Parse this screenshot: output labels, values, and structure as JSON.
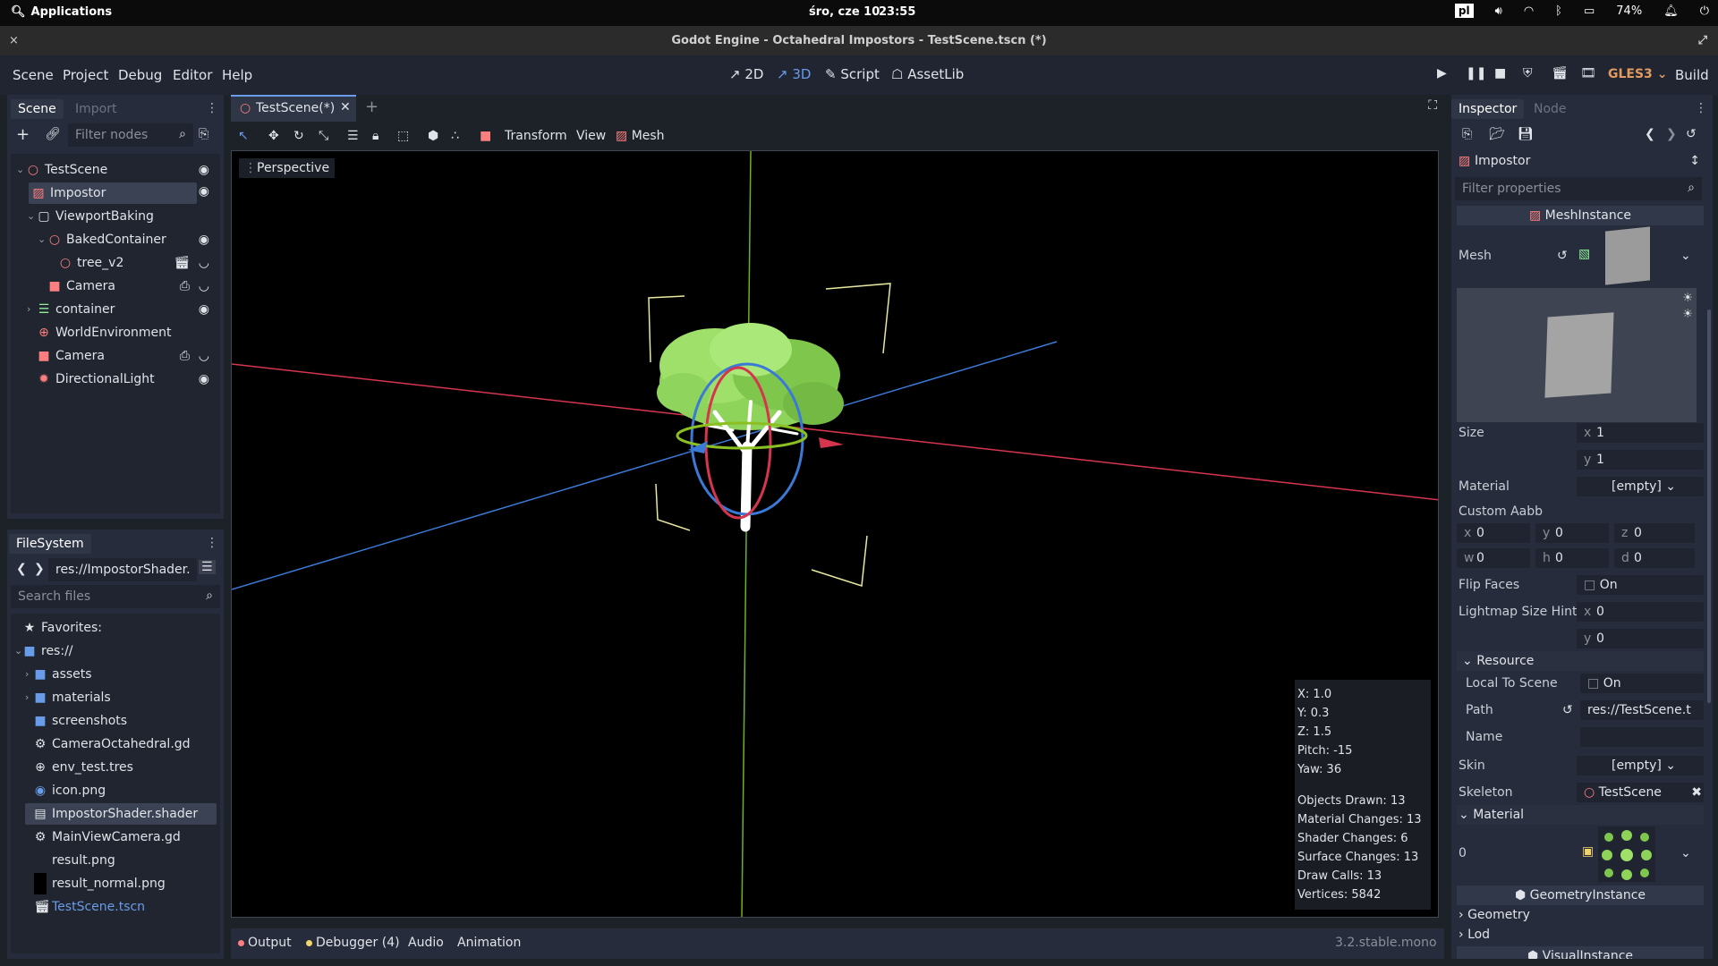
{
  "os_bar": {
    "applications": "Applications",
    "date": "śro, cze 10",
    "time": "23:55",
    "keyboard": "pl",
    "battery": "74%"
  },
  "window": {
    "title": "Godot Engine - Octahedral Impostors - TestScene.tscn (*)",
    "close": "×"
  },
  "menu": {
    "items": [
      "Scene",
      "Project",
      "Debug",
      "Editor",
      "Help"
    ],
    "workspaces": [
      "2D",
      "3D",
      "Script",
      "AssetLib"
    ],
    "renderer": "GLES3",
    "build": "Build"
  },
  "scene_dock": {
    "tabs": [
      "Scene",
      "Import"
    ],
    "filter_placeholder": "Filter nodes",
    "nodes": [
      {
        "name": "TestScene"
      },
      {
        "name": "Impostor"
      },
      {
        "name": "ViewportBaking"
      },
      {
        "name": "BakedContainer"
      },
      {
        "name": "tree_v2"
      },
      {
        "name": "Camera"
      },
      {
        "name": "container"
      },
      {
        "name": "WorldEnvironment"
      },
      {
        "name": "Camera"
      },
      {
        "name": "DirectionalLight"
      }
    ]
  },
  "filesystem": {
    "tab": "FileSystem",
    "path": "res://ImpostorShader.",
    "search_placeholder": "Search files",
    "items": [
      {
        "name": "Favorites:"
      },
      {
        "name": "res://"
      },
      {
        "name": "assets"
      },
      {
        "name": "materials"
      },
      {
        "name": "screenshots"
      },
      {
        "name": "CameraOctahedral.gd"
      },
      {
        "name": "env_test.tres"
      },
      {
        "name": "icon.png"
      },
      {
        "name": "ImpostorShader.shader"
      },
      {
        "name": "MainViewCamera.gd"
      },
      {
        "name": "result.png"
      },
      {
        "name": "result_normal.png"
      },
      {
        "name": "TestScene.tscn"
      }
    ]
  },
  "editor": {
    "scene_tab": "TestScene(*)",
    "toolbar": [
      "Transform",
      "View",
      "Mesh"
    ],
    "perspective": "Perspective",
    "stats": {
      "x": "X: 1.0",
      "y": "Y: 0.3",
      "z": "Z: 1.5",
      "pitch": "Pitch: -15",
      "yaw": "Yaw: 36",
      "objects": "Objects Drawn: 13",
      "materials": "Material Changes: 13",
      "shaders": "Shader Changes: 6",
      "surfaces": "Surface Changes: 13",
      "draw_calls": "Draw Calls: 13",
      "vertices": "Vertices: 5842"
    }
  },
  "bottom_panel": {
    "tabs": [
      "Output",
      "Debugger (4)",
      "Audio",
      "Animation"
    ],
    "version": "3.2.stable.mono"
  },
  "inspector": {
    "tabs": [
      "Inspector",
      "Node"
    ],
    "node_name": "Impostor",
    "filter_placeholder": "Filter properties",
    "mesh_instance": "MeshInstance",
    "mesh_label": "Mesh",
    "size_label": "Size",
    "size_x": "1",
    "size_y": "1",
    "material_label": "Material",
    "material_value": "[empty]",
    "custom_aabb": "Custom Aabb",
    "aabb": {
      "x": "0",
      "y": "0",
      "z": "0",
      "w": "0",
      "h": "0",
      "d": "0"
    },
    "flip_faces": "Flip Faces",
    "on": "On",
    "lightmap": "Lightmap Size Hint",
    "lightmap_x": "0",
    "lightmap_y": "0",
    "resource": "Resource",
    "local_to_scene": "Local To Scene",
    "path_label": "Path",
    "path_value": "res://TestScene.t",
    "name_label": "Name",
    "skin_label": "Skin",
    "skin_value": "[empty]",
    "skeleton_label": "Skeleton",
    "skeleton_value": "TestScene",
    "material_section": "Material",
    "material_index": "0",
    "geometry_instance": "GeometryInstance",
    "geometry": "Geometry",
    "lod": "Lod",
    "visual_instance": "VisualInstance"
  }
}
